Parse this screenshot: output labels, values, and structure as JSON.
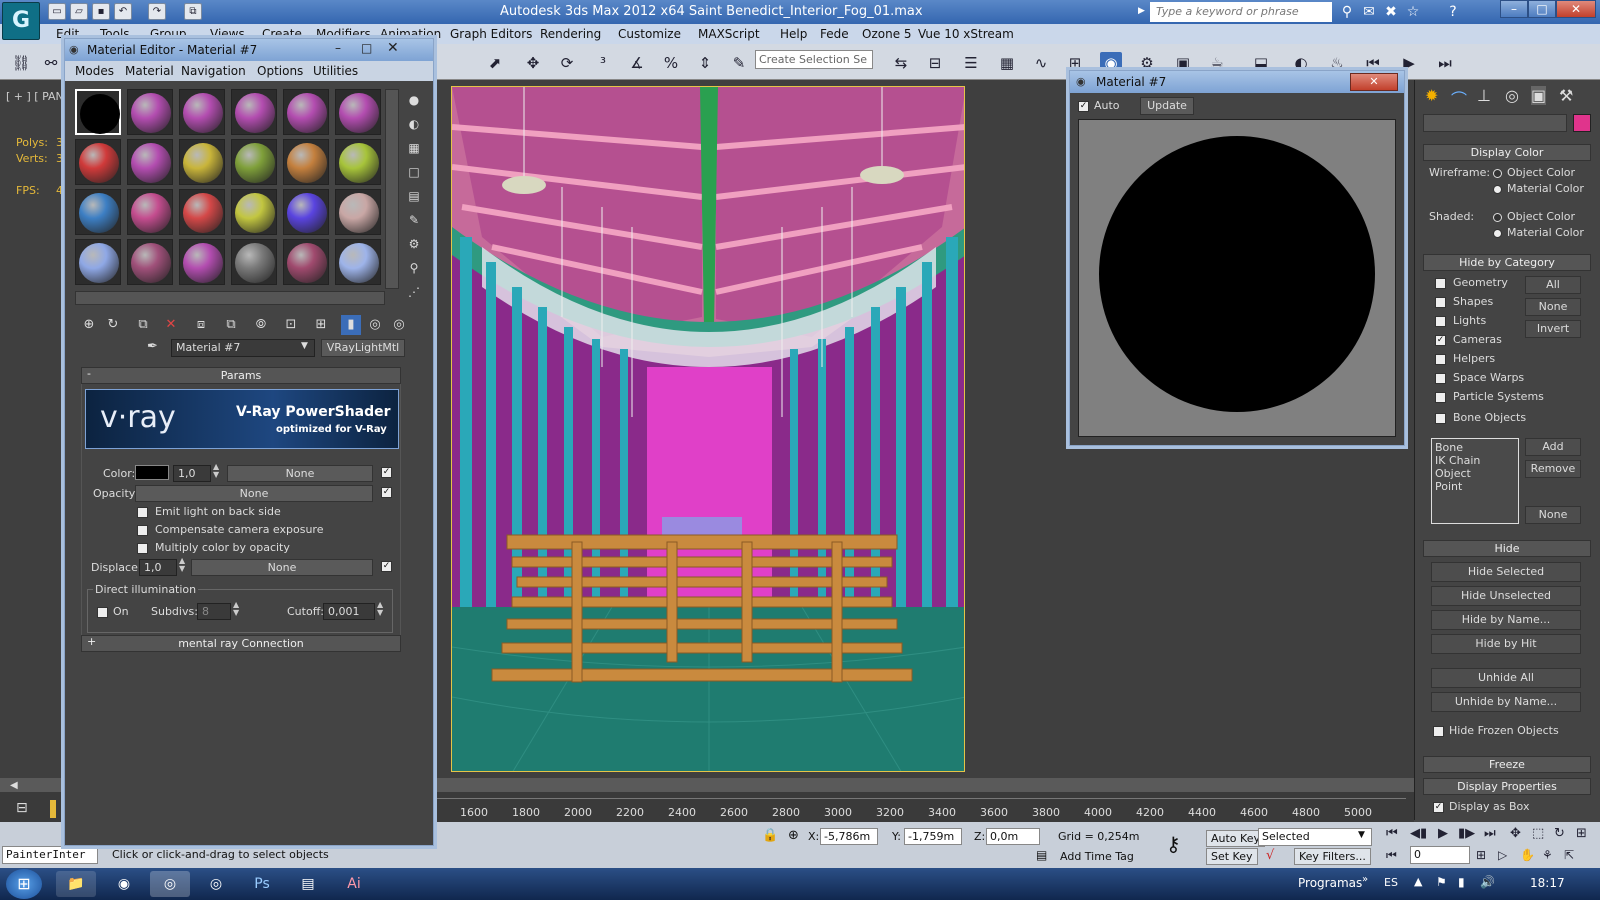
{
  "app": {
    "title": "Autodesk 3ds Max  2012 x64      Saint Benedict_Interior_Fog_01.max",
    "search_placeholder": "Type a keyword or phrase",
    "logo": "G"
  },
  "menu": [
    "Edit",
    "Tools",
    "Group",
    "Views",
    "Create",
    "Modifiers",
    "Animation",
    "Graph Editors",
    "Rendering",
    "Customize",
    "MAXScript",
    "Help",
    "Fede",
    "Ozone 5",
    "Vue 10 xStream"
  ],
  "toolbar": {
    "selection_set_placeholder": "Create Selection Se"
  },
  "viewport": {
    "label": "[ + ] [ PAND",
    "stats": [
      {
        "label": "Polys:",
        "value": "3"
      },
      {
        "label": "Verts:",
        "value": "3"
      },
      {
        "label": "FPS:",
        "value": "4"
      }
    ]
  },
  "material_editor": {
    "title": "Material Editor - Material #7",
    "menu": [
      "Modes",
      "Material",
      "Navigation",
      "Options",
      "Utilities"
    ],
    "slot_colors": [
      "#000000",
      "#b34db0",
      "#b34db0",
      "#b34db0",
      "#b34db0",
      "#b34db0",
      "#d03a3a",
      "#b34db0",
      "#c9b53a",
      "#7fa03a",
      "#c4803e",
      "#a7c43a",
      "#3d7fc4",
      "#c44d8f",
      "#d44848",
      "#c2c640",
      "#5a44e0",
      "#c9a7a5",
      "#8fa8e6",
      "#a0507a",
      "#b34db0",
      "#7a7a7a",
      "#a04a6e",
      "#9eb4ea"
    ],
    "material_name": "Material #7",
    "material_type": "VRayLightMtl",
    "params_label": "Params",
    "vray_logo": "v·ray",
    "vray_title": "V-Ray PowerShader",
    "vray_subtitle": "optimized for V-Ray",
    "color_label": "Color:",
    "color_value": "1,0",
    "none": "None",
    "opacity_label": "Opacity:",
    "emit_back": "Emit light on back side",
    "compensate": "Compensate camera exposure",
    "multiply": "Multiply color by opacity",
    "displace_label": "Displace:",
    "displace_value": "1,0",
    "direct_illum": "Direct illumination",
    "on_label": "On",
    "subdivs_label": "Subdivs:",
    "subdivs_value": "8",
    "cutoff_label": "Cutoff:",
    "cutoff_value": "0,001",
    "mental_ray": "mental ray Connection",
    "collapse": "-",
    "expand": "+"
  },
  "preview": {
    "title": "Material #7",
    "auto": "Auto",
    "update": "Update"
  },
  "command_panel": {
    "display_color": "Display Color",
    "wireframe": "Wireframe:",
    "shaded": "Shaded:",
    "object_color": "Object Color",
    "material_color": "Material Color",
    "hide_by_category": "Hide by Category",
    "categories": [
      "Geometry",
      "Shapes",
      "Lights",
      "Cameras",
      "Helpers",
      "Space Warps",
      "Particle Systems",
      "Bone Objects"
    ],
    "cat_buttons": [
      "All",
      "None",
      "Invert"
    ],
    "list_items": [
      "Bone",
      "IK Chain Object",
      "Point"
    ],
    "list_buttons": [
      "Add",
      "Remove",
      "None"
    ],
    "hide": "Hide",
    "hide_buttons": [
      "Hide Selected",
      "Hide Unselected",
      "Hide by Name...",
      "Hide by Hit"
    ],
    "unhide_buttons": [
      "Unhide All",
      "Unhide by Name..."
    ],
    "hide_frozen": "Hide Frozen Objects",
    "freeze": "Freeze",
    "display_properties": "Display Properties",
    "display_as_box": "Display as Box"
  },
  "timeline": {
    "ticks": [
      "1600",
      "1800",
      "2000",
      "2200",
      "2400",
      "2600",
      "2800",
      "3000",
      "3200",
      "3400",
      "3600",
      "3800",
      "4000",
      "4200",
      "4400",
      "4600",
      "4800",
      "5000"
    ]
  },
  "status": {
    "painter": "PainterInter",
    "prompt": "Click or click-and-drag to select objects",
    "x_label": "X:",
    "x_value": "-5,786m",
    "y_label": "Y:",
    "y_value": "-1,759m",
    "z_label": "Z:",
    "z_value": "0,0m",
    "grid": "Grid = 0,254m",
    "add_time_tag": "Add Time Tag",
    "auto_key": "Auto Key",
    "set_key": "Set Key",
    "selected": "Selected",
    "key_filters": "Key Filters...",
    "frame": "0"
  },
  "taskbar": {
    "programas": "Programas",
    "lang": "ES",
    "time": "18:17"
  }
}
